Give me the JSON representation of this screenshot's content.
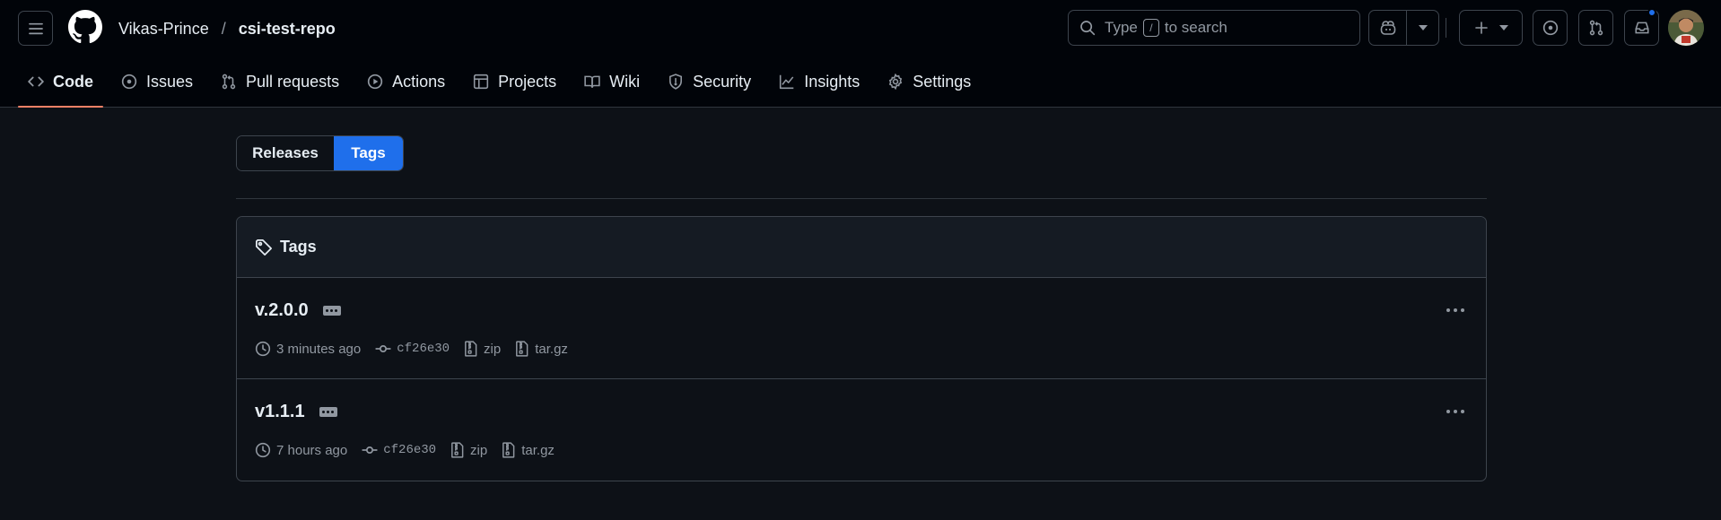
{
  "header": {
    "owner": "Vikas-Prince",
    "separator": "/",
    "repo": "csi-test-repo",
    "search": {
      "prefix": "Type",
      "key": "/",
      "suffix": "to search"
    }
  },
  "nav": {
    "code": "Code",
    "issues": "Issues",
    "pulls": "Pull requests",
    "actions": "Actions",
    "projects": "Projects",
    "wiki": "Wiki",
    "security": "Security",
    "insights": "Insights",
    "settings": "Settings"
  },
  "tabs": {
    "releases": "Releases",
    "tags": "Tags"
  },
  "box": {
    "title": "Tags",
    "tags": [
      {
        "name": "v.2.0.0",
        "time": "3 minutes ago",
        "sha": "cf26e30",
        "zip": "zip",
        "targz": "tar.gz"
      },
      {
        "name": "v1.1.1",
        "time": "7 hours ago",
        "sha": "cf26e30",
        "zip": "zip",
        "targz": "tar.gz"
      }
    ]
  },
  "colors": {
    "accent": "#1f6feb",
    "nav_underline": "#f78166",
    "background": "#0d1117",
    "header_bg": "#010409"
  }
}
